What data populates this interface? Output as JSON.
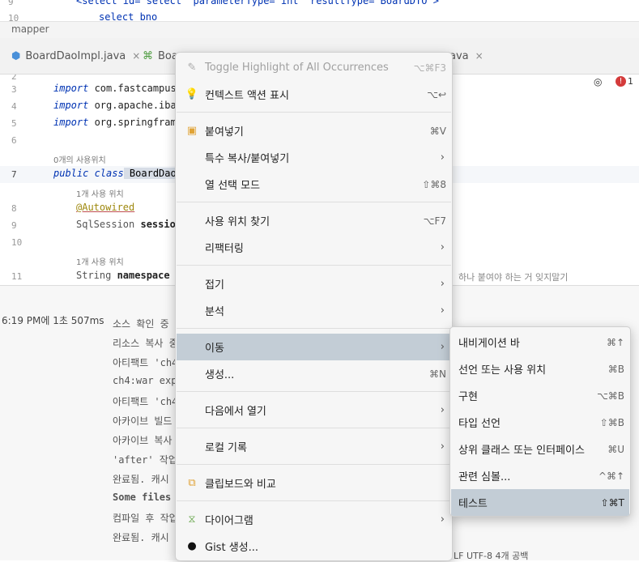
{
  "editor_top": {
    "line9_num": "9",
    "line9_code": "<select id=\"select\" parameterType=\"int\" resultType=\"BoardDTO\">",
    "line10_num": "10",
    "line10_code": "select bno"
  },
  "breadcrumb": "mapper",
  "tabs": [
    {
      "label": "BoardDaoImpl.java",
      "close": "×"
    },
    {
      "label": "Boa",
      "close": ""
    },
    {
      "label": "",
      "close": ""
    },
    {
      "label": "ava",
      "close": "×"
    }
  ],
  "editor": {
    "lines": [
      {
        "num": "2",
        "code": ""
      },
      {
        "num": "3",
        "kw": "import",
        "rest": " com.fastcampus."
      },
      {
        "num": "4",
        "kw": "import",
        "rest": " org.apache.ibat"
      },
      {
        "num": "5",
        "kw": "import",
        "rest": " org.springframe"
      },
      {
        "num": "6",
        "code": ""
      },
      {
        "num": "7",
        "kw": "public class",
        "rest": " BoardDao"
      },
      {
        "num": "8",
        "annotation": "@Autowired"
      },
      {
        "num": "9",
        "type": "SqlSession",
        "var": " session"
      },
      {
        "num": "10",
        "code": ""
      },
      {
        "num": "11",
        "type": "String",
        "var": " namespace",
        "eq": " ="
      }
    ],
    "usage_hints": [
      "0개의 사용위치",
      "1개 사용 위치",
      "1개 사용 위치"
    ],
    "right_comment": "하나 붙여야 하는 거 잊지말기",
    "problems_count": "1"
  },
  "build": {
    "time": "6:19 PM에 1초 507ms",
    "log": [
      "소스 확인 중",
      "리소스 복사 중",
      "아티팩트 'ch4",
      "ch4:war exp",
      "아티팩트 'ch4",
      "아카이브 빌드",
      "아카이브 복사",
      "'after' 작업",
      "완료됨. 캐시 저",
      "Some files",
      "컴파일 후 작업",
      "완료됨. 캐시 저"
    ],
    "status": "LF  UTF-8  4개 공백"
  },
  "context_menu": {
    "items": [
      {
        "label": "Toggle Highlight of All Occurrences",
        "shortcut": "⌥⌘F3",
        "icon": "highlight-icon",
        "disabled": true
      },
      {
        "label": "컨텍스트 액션 표시",
        "shortcut": "⌥↩",
        "icon": "lightbulb-icon"
      },
      {
        "label": "붙여넣기",
        "shortcut": "⌘V",
        "icon": "clipboard-icon"
      },
      {
        "label": "특수 복사/붙여넣기",
        "arrow": "›"
      },
      {
        "label": "열 선택 모드",
        "shortcut": "⇧⌘8"
      },
      {
        "label": "사용 위치 찾기",
        "shortcut": "⌥F7"
      },
      {
        "label": "리팩터링",
        "arrow": "›"
      },
      {
        "label": "접기",
        "arrow": "›"
      },
      {
        "label": "분석",
        "arrow": "›"
      },
      {
        "label": "이동",
        "arrow": "›",
        "active": true
      },
      {
        "label": "생성...",
        "shortcut": "⌘N"
      },
      {
        "label": "다음에서 열기",
        "arrow": "›"
      },
      {
        "label": "로컬 기록",
        "arrow": "›"
      },
      {
        "label": "클립보드와 비교",
        "icon": "compare-icon"
      },
      {
        "label": "다이어그램",
        "arrow": "›",
        "icon": "diagram-icon"
      },
      {
        "label": "Gist 생성...",
        "icon": "github-icon"
      }
    ]
  },
  "submenu": {
    "items": [
      {
        "label": "내비게이션 바",
        "shortcut": "⌘↑"
      },
      {
        "label": "선언 또는 사용 위치",
        "shortcut": "⌘B"
      },
      {
        "label": "구현",
        "shortcut": "⌥⌘B"
      },
      {
        "label": "타입 선언",
        "shortcut": "⇧⌘B"
      },
      {
        "label": "상위 클래스 또는 인터페이스",
        "shortcut": "⌘U"
      },
      {
        "label": "관련 심볼...",
        "shortcut": "^⌘↑"
      },
      {
        "label": "테스트",
        "shortcut": "⇧⌘T",
        "active": true
      }
    ]
  },
  "colors": {
    "keyword": "#0033b3",
    "highlight_bg": "#c3cdd6",
    "annotation": "#9e880d"
  }
}
